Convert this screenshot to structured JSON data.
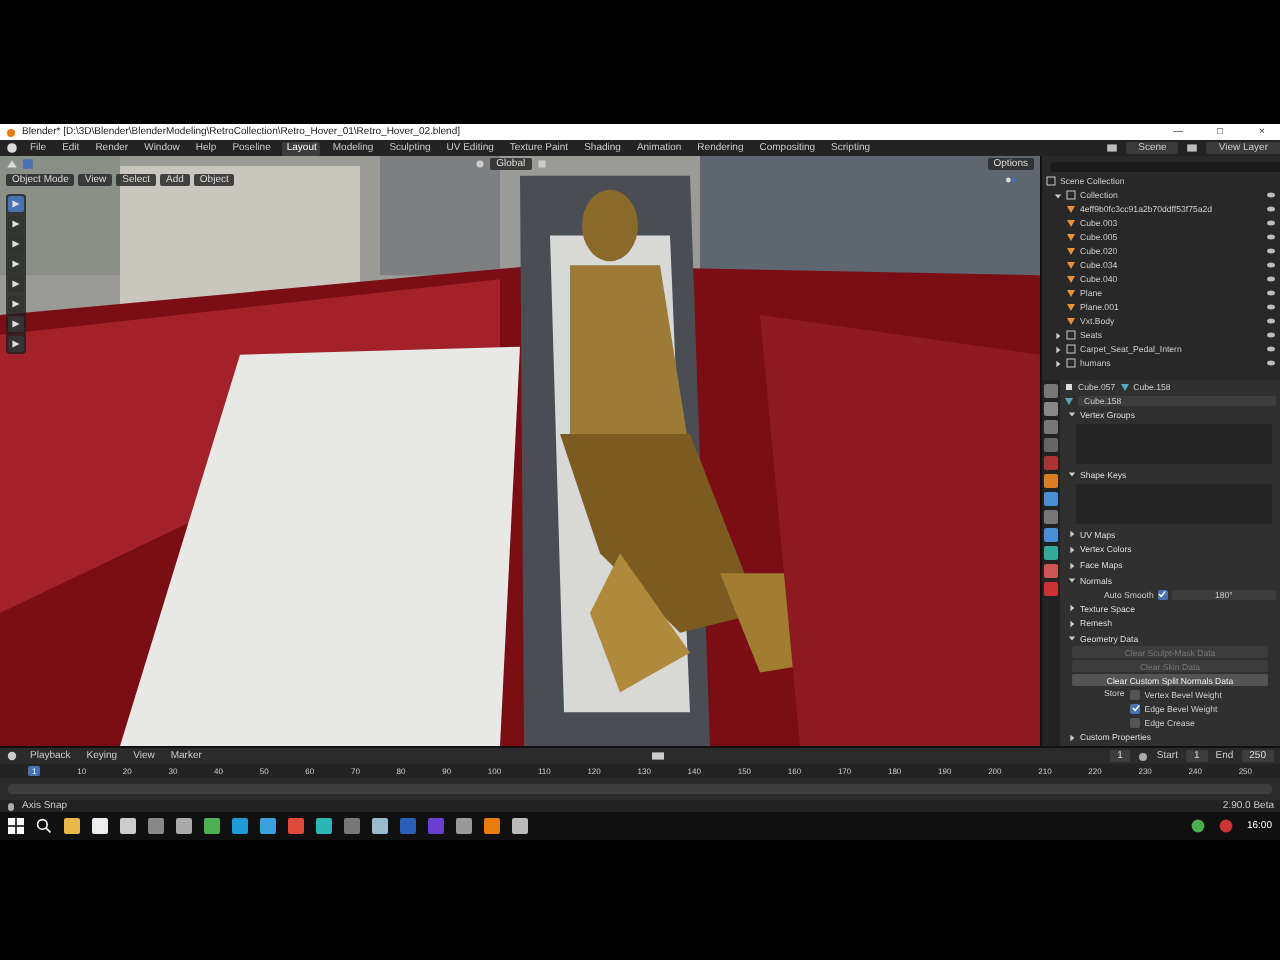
{
  "title_bar": {
    "title": "Blender* [D:\\3D\\Blender\\BlenderModeling\\RetroCollection\\Retro_Hover_01\\Retro_Hover_02.blend]",
    "controls": [
      "—",
      "□",
      "×"
    ]
  },
  "menu": [
    "File",
    "Edit",
    "Render",
    "Window",
    "Help",
    "Poseline"
  ],
  "workspaces": [
    {
      "label": "Layout",
      "selected": true
    },
    {
      "label": "Modeling",
      "selected": false
    },
    {
      "label": "Sculpting",
      "selected": false
    },
    {
      "label": "UV Editing",
      "selected": false
    },
    {
      "label": "Texture Paint",
      "selected": false
    },
    {
      "label": "Shading",
      "selected": false
    },
    {
      "label": "Animation",
      "selected": false
    },
    {
      "label": "Rendering",
      "selected": false
    },
    {
      "label": "Compositing",
      "selected": false
    },
    {
      "label": "Scripting",
      "selected": false
    }
  ],
  "scene": "Scene",
  "view_layer": "View Layer",
  "viewport": {
    "mode": "Object Mode",
    "menus": [
      "View",
      "Select",
      "Add",
      "Object"
    ],
    "orientation": "Global",
    "options": "Options"
  },
  "outliner": {
    "root": "Scene Collection",
    "items": [
      {
        "label": "Collection",
        "expanded": true,
        "children": [
          {
            "label": "4eff9b0fc3cc91a2b70ddff53f75a2d"
          },
          {
            "label": "Cube.003"
          },
          {
            "label": "Cube.005"
          },
          {
            "label": "Cube.020"
          },
          {
            "label": "Cube.034"
          },
          {
            "label": "Cube.040"
          },
          {
            "label": "Plane"
          },
          {
            "label": "Plane.001"
          },
          {
            "label": "Vxt.Body"
          }
        ]
      },
      {
        "label": "Seats",
        "expanded": false
      },
      {
        "label": "Carpet_Seat_Pedal_Intern",
        "expanded": false
      },
      {
        "label": "humans",
        "expanded": false
      }
    ]
  },
  "properties": {
    "object": "Cube.057",
    "mesh": "Cube.158",
    "data_name": "Cube.158",
    "panels": [
      {
        "kind": "list",
        "label": "Vertex Groups",
        "expanded": true
      },
      {
        "kind": "list",
        "label": "Shape Keys",
        "expanded": true
      },
      {
        "label": "UV Maps",
        "expanded": false
      },
      {
        "label": "Vertex Colors",
        "expanded": false
      },
      {
        "label": "Face Maps",
        "expanded": false
      },
      {
        "kind": "normals",
        "label": "Normals",
        "expanded": true,
        "auto_smooth": {
          "label": "Auto Smooth",
          "checked": true
        },
        "angle": "180°"
      },
      {
        "label": "Texture Space",
        "expanded": false
      },
      {
        "label": "Remesh",
        "expanded": false
      },
      {
        "kind": "geometry",
        "label": "Geometry Data",
        "expanded": true,
        "buttons": [
          {
            "label": "Clear Sculpt-Mask Data",
            "disabled": true
          },
          {
            "label": "Clear Skin Data",
            "disabled": true
          },
          {
            "label": "Clear Custom Split Normals Data",
            "disabled": false
          }
        ],
        "store_label": "Store",
        "store": [
          {
            "label": "Vertex Bevel Weight",
            "checked": false
          },
          {
            "label": "Edge Bevel Weight",
            "checked": true
          },
          {
            "label": "Edge Crease",
            "checked": false
          }
        ]
      },
      {
        "label": "Custom Properties",
        "expanded": false
      }
    ]
  },
  "timeline": {
    "menus": [
      "Playback",
      "Keying",
      "View",
      "Marker"
    ],
    "current": "1",
    "start_label": "Start",
    "start": "1",
    "end_label": "End",
    "end": "250",
    "ticks": [
      "1",
      "10",
      "20",
      "30",
      "40",
      "50",
      "60",
      "70",
      "80",
      "90",
      "100",
      "110",
      "120",
      "130",
      "140",
      "150",
      "160",
      "170",
      "180",
      "190",
      "200",
      "210",
      "220",
      "230",
      "240",
      "250"
    ]
  },
  "status_bar": {
    "hint": "Axis Snap",
    "version": "2.90.0 Beta"
  },
  "taskbar": {
    "clock": "16:00"
  }
}
